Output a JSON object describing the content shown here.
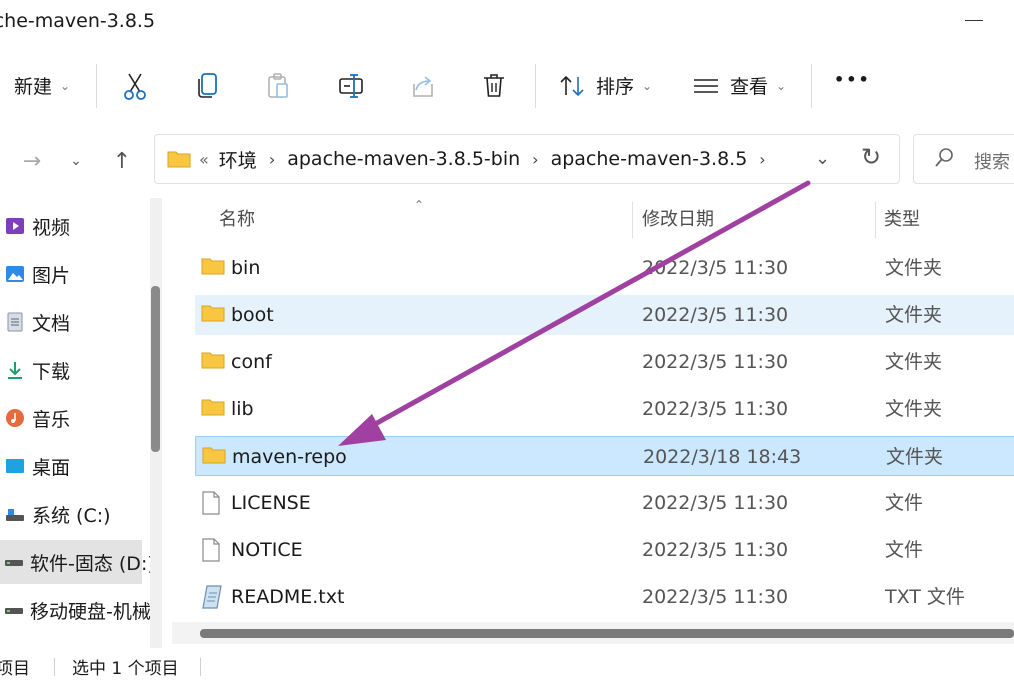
{
  "window": {
    "title": "pache-maven-3.8.5"
  },
  "ribbon": {
    "new_label": "新建",
    "sort_label": "排序",
    "view_label": "查看",
    "more_label": "•••"
  },
  "nav": {
    "path_prefix": "«",
    "breadcrumbs": [
      "环境",
      "apache-maven-3.8.5-bin",
      "apache-maven-3.8.5"
    ],
    "search_placeholder": "搜索"
  },
  "sidebar": {
    "items": [
      {
        "label": "视频",
        "icon": "video-icon"
      },
      {
        "label": "图片",
        "icon": "pictures-icon"
      },
      {
        "label": "文档",
        "icon": "documents-icon"
      },
      {
        "label": "下载",
        "icon": "downloads-icon"
      },
      {
        "label": "音乐",
        "icon": "music-icon"
      },
      {
        "label": "桌面",
        "icon": "desktop-icon"
      },
      {
        "label": "系统 (C:)",
        "icon": "drive-icon"
      },
      {
        "label": "软件-固态 (D:)",
        "icon": "drive-icon"
      },
      {
        "label": "移动硬盘-机械",
        "icon": "drive-icon"
      }
    ]
  },
  "columns": {
    "name": "名称",
    "date": "修改日期",
    "type": "类型"
  },
  "files": [
    {
      "name": "bin",
      "date": "2022/3/5 11:30",
      "type": "文件夹",
      "icon": "folder-icon"
    },
    {
      "name": "boot",
      "date": "2022/3/5 11:30",
      "type": "文件夹",
      "icon": "folder-icon"
    },
    {
      "name": "conf",
      "date": "2022/3/5 11:30",
      "type": "文件夹",
      "icon": "folder-icon"
    },
    {
      "name": "lib",
      "date": "2022/3/5 11:30",
      "type": "文件夹",
      "icon": "folder-icon"
    },
    {
      "name": "maven-repo",
      "date": "2022/3/18 18:43",
      "type": "文件夹",
      "icon": "folder-icon"
    },
    {
      "name": "LICENSE",
      "date": "2022/3/5 11:30",
      "type": "文件",
      "icon": "file-icon"
    },
    {
      "name": "NOTICE",
      "date": "2022/3/5 11:30",
      "type": "文件",
      "icon": "file-icon"
    },
    {
      "name": "README.txt",
      "date": "2022/3/5 11:30",
      "type": "TXT 文件",
      "icon": "text-file-icon"
    }
  ],
  "status": {
    "items": "项目",
    "selected": "选中 1 个项目"
  },
  "colors": {
    "accent": "#0067c0",
    "selected_row": "#cce8ff",
    "hover_row": "#e5f1fb",
    "arrow": "#a040a0",
    "folder": "#f8c640"
  }
}
